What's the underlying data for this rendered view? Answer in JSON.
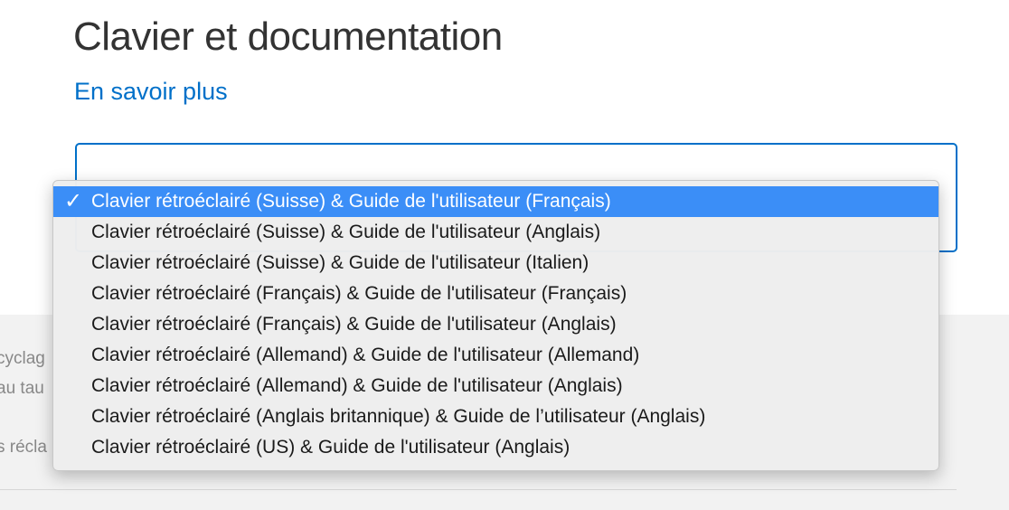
{
  "page": {
    "title": "Clavier et documentation",
    "learn_more": "En savoir plus"
  },
  "background_text": [
    "cyclag",
    "au tau",
    "s récla"
  ],
  "dropdown": {
    "check_icon": "✓",
    "options": [
      {
        "label": "Clavier rétroéclairé (Suisse) & Guide de l'utilisateur (Français)",
        "selected": true
      },
      {
        "label": "Clavier rétroéclairé (Suisse) & Guide de l'utilisateur (Anglais)"
      },
      {
        "label": "Clavier rétroéclairé (Suisse) & Guide de l'utilisateur (Italien)"
      },
      {
        "label": "Clavier rétroéclairé (Français) & Guide de l'utilisateur (Français)"
      },
      {
        "label": "Clavier rétroéclairé (Français) & Guide de l'utilisateur (Anglais)"
      },
      {
        "label": "Clavier rétroéclairé (Allemand) & Guide de l'utilisateur (Allemand)"
      },
      {
        "label": "Clavier rétroéclairé (Allemand) & Guide de l'utilisateur (Anglais)"
      },
      {
        "label": "Clavier rétroéclairé (Anglais britannique) & Guide de l’utilisateur (Anglais)"
      },
      {
        "label": "Clavier rétroéclairé (US) & Guide de l'utilisateur (Anglais)"
      }
    ]
  },
  "colors": {
    "link": "#0070c9",
    "selected_bg": "#3b8ef7",
    "title_text": "#333333"
  }
}
